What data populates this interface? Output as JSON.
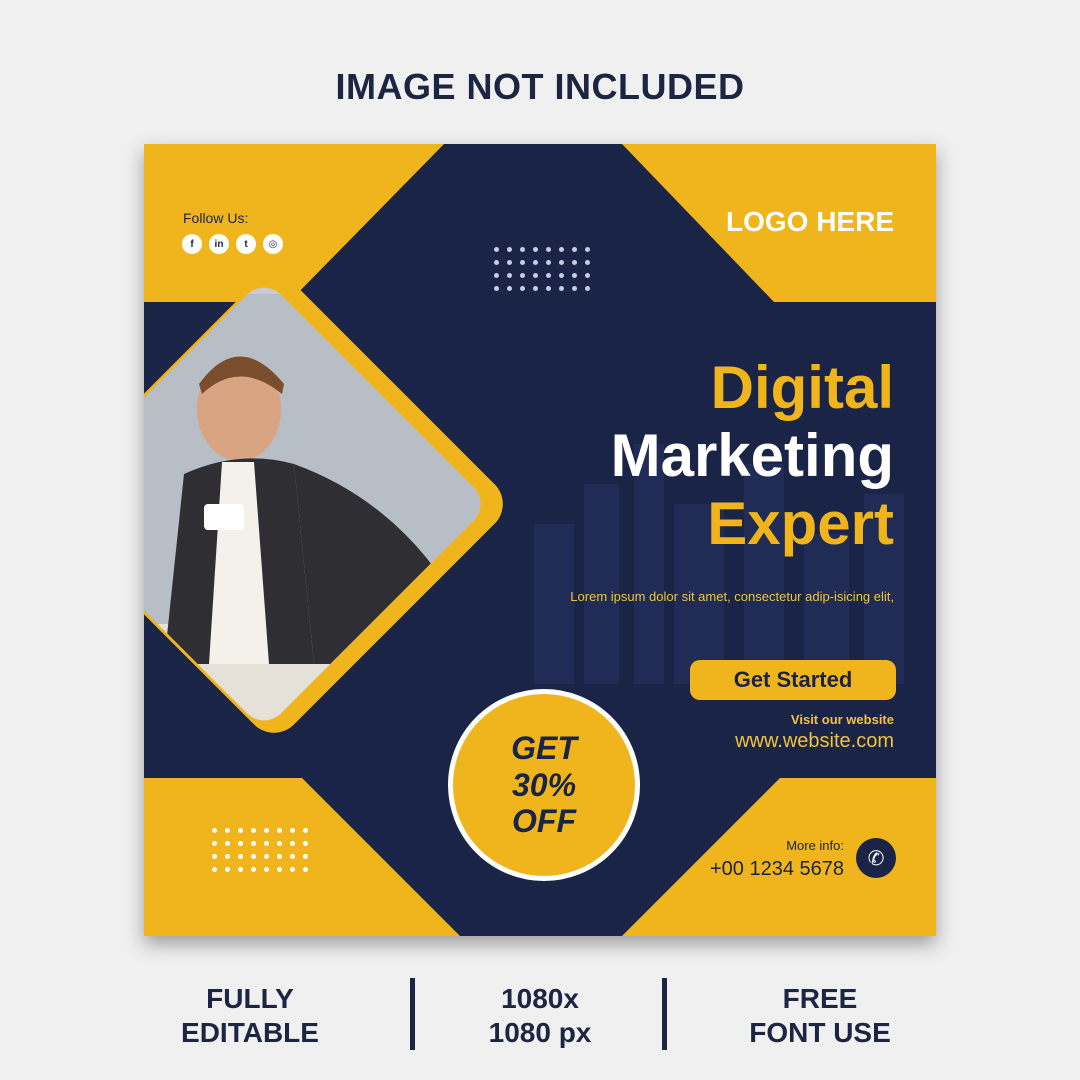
{
  "notice": "IMAGE NOT INCLUDED",
  "colors": {
    "accent_yellow": "#f0b41c",
    "navy": "#1a2447",
    "page_bg": "#f0f0f0"
  },
  "card": {
    "follow_label": "Follow Us:",
    "socials": [
      {
        "icon": "facebook-icon",
        "glyph": "f"
      },
      {
        "icon": "linkedin-icon",
        "glyph": "in"
      },
      {
        "icon": "twitter-icon",
        "glyph": "t"
      },
      {
        "icon": "instagram-icon",
        "glyph": "◎"
      }
    ],
    "logo": "LOGO HERE",
    "headline": {
      "line1": "Digital",
      "line2": "Marketing",
      "line3": "Expert"
    },
    "body": "Lorem ipsum dolor sit amet, consectetur adip-isicing elit,",
    "cta_label": "Get Started",
    "visit_label": "Visit our website",
    "website": "www.website.com",
    "discount": {
      "line1": "GET",
      "line2": "30%",
      "line3": "OFF"
    },
    "more_info_label": "More info:",
    "phone": "+00 1234 5678",
    "phone_icon": "phone-icon"
  },
  "features": {
    "item1": {
      "line1": "FULLY",
      "line2": "EDITABLE"
    },
    "item2": {
      "line1": "1080x",
      "line2": "1080 px"
    },
    "item3": {
      "line1": "FREE",
      "line2": "FONT USE"
    }
  }
}
